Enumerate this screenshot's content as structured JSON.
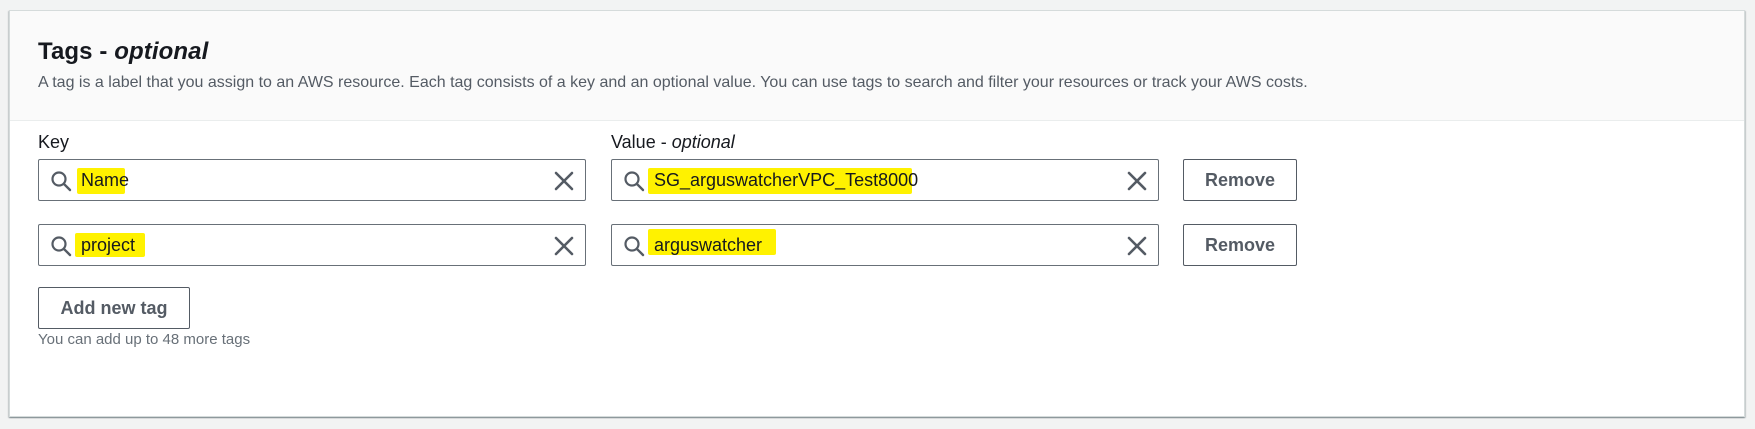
{
  "section": {
    "title_main": "Tags - ",
    "title_optional": "optional",
    "description": "A tag is a label that you assign to an AWS resource. Each tag consists of a key and an optional value. You can use tags to search and filter your resources or track your AWS costs."
  },
  "columns": {
    "key_label": "Key",
    "value_label_main": "Value - ",
    "value_label_optional": "optional"
  },
  "tags": [
    {
      "key": "Name",
      "value": "SG_arguswatcherVPC_Test8000",
      "remove_label": "Remove"
    },
    {
      "key": "project",
      "value": "arguswatcher",
      "remove_label": "Remove"
    }
  ],
  "add_button_label": "Add new tag",
  "limit_hint": "You can add up to 48 more tags",
  "icons": {
    "search": "search-icon",
    "clear": "close-icon"
  },
  "colors": {
    "highlight": "#fff200",
    "border": "#687078",
    "text": "#16191f",
    "secondary_text": "#545b64"
  }
}
